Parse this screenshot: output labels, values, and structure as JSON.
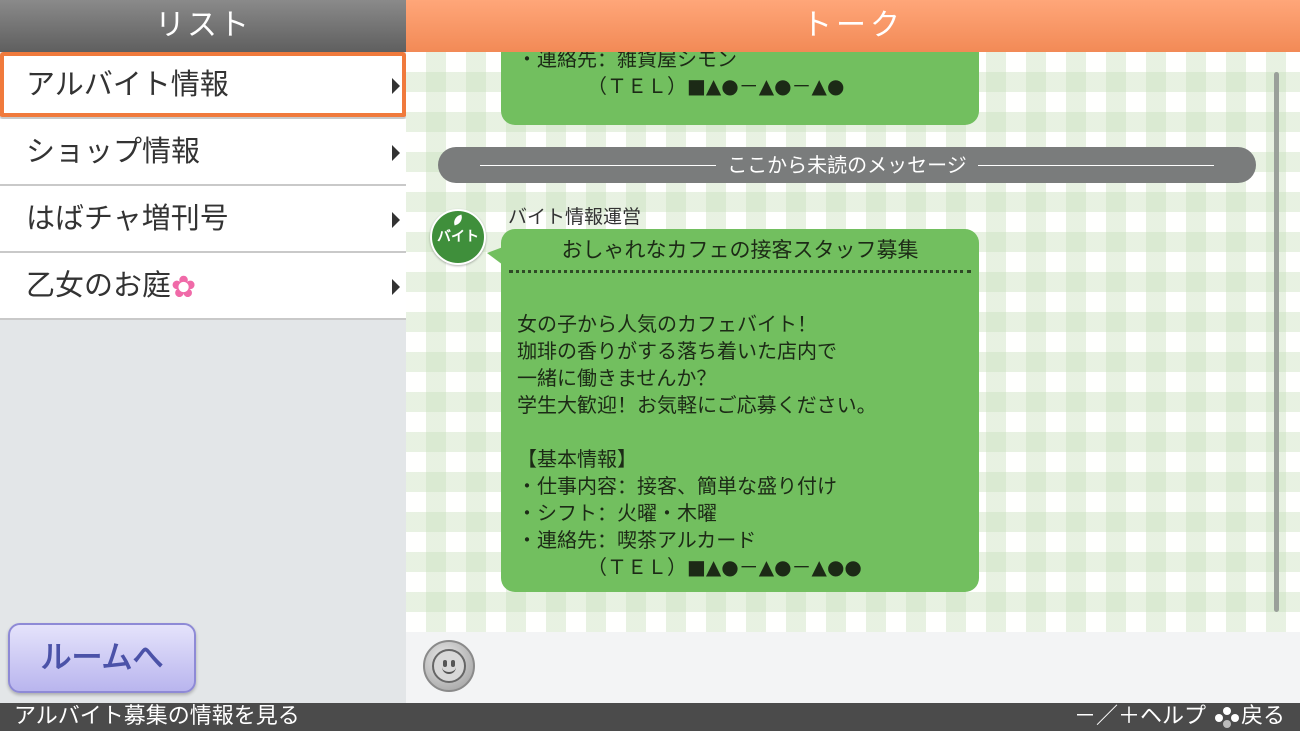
{
  "sidebar": {
    "title": "リスト",
    "items": [
      {
        "label": "アルバイト情報"
      },
      {
        "label": "ショップ情報"
      },
      {
        "label": "はばチャ増刊号"
      },
      {
        "label": "乙女のお庭"
      }
    ],
    "room_button": "ルームへ"
  },
  "talk": {
    "title": "トーク",
    "prev_message_lines": [
      "・連絡先：雑貨屋シモン",
      "　　　　（ＴＥＬ）■▲●－▲●－▲●"
    ],
    "unread_divider": "ここから未読のメッセージ",
    "avatar_label": "バイト",
    "sender": "バイト情報運営",
    "message": {
      "title": "おしゃれなカフェの接客スタッフ募集",
      "lines": [
        "女の子から人気のカフェバイト！",
        "珈琲の香りがする落ち着いた店内で",
        "一緒に働きませんか？",
        "学生大歓迎！お気軽にご応募ください。",
        "",
        "【基本情報】",
        "・仕事内容：接客、簡単な盛り付け",
        "・シフト：火曜・木曜",
        "・連絡先：喫茶アルカード",
        "　　　　（ＴＥＬ）■▲●－▲●－▲●●"
      ]
    }
  },
  "footer": {
    "description": "アルバイト募集の情報を見る",
    "help": "－／＋ヘルプ",
    "back": "戻る"
  }
}
